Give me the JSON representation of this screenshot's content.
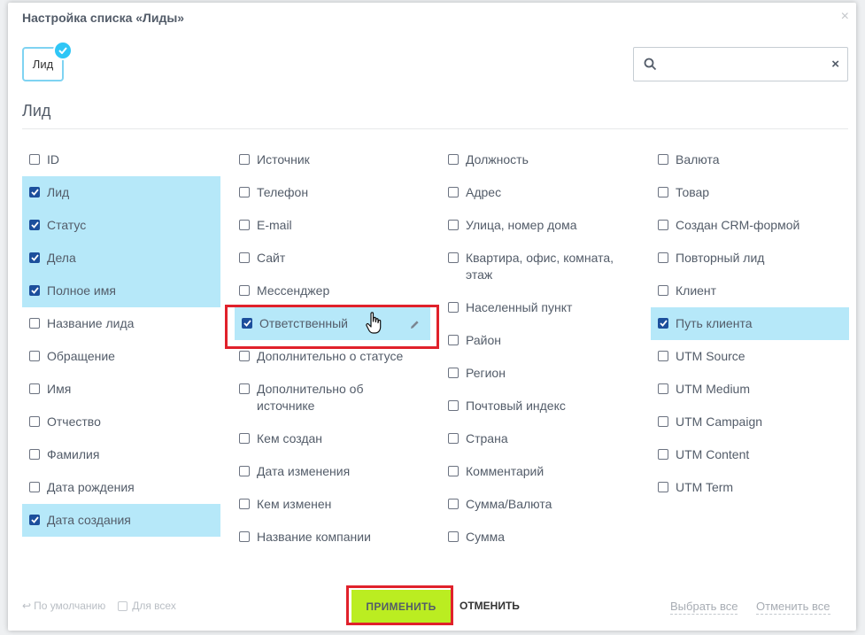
{
  "dialog": {
    "title": "Настройка списка «Лиды»",
    "close_icon": "close-icon"
  },
  "entity_tag": {
    "label": "Лид",
    "selected": true
  },
  "search": {
    "value": "",
    "placeholder": ""
  },
  "section_title": "Лид",
  "colors": {
    "checked_bg": "#b6e8f9",
    "checkbox_fill": "#1c4f9c",
    "apply_bg": "#bbed21",
    "highlight_border": "#e0212b"
  },
  "columns": [
    [
      {
        "label": "ID",
        "checked": false
      },
      {
        "label": "Лид",
        "checked": true
      },
      {
        "label": "Статус",
        "checked": true
      },
      {
        "label": "Дела",
        "checked": true
      },
      {
        "label": "Полное имя",
        "checked": true
      },
      {
        "label": "Название лида",
        "checked": false
      },
      {
        "label": "Обращение",
        "checked": false
      },
      {
        "label": "Имя",
        "checked": false
      },
      {
        "label": "Отчество",
        "checked": false
      },
      {
        "label": "Фамилия",
        "checked": false
      },
      {
        "label": "Дата рождения",
        "checked": false
      },
      {
        "label": "Дата создания",
        "checked": true
      }
    ],
    [
      {
        "label": "Источник",
        "checked": false
      },
      {
        "label": "Телефон",
        "checked": false
      },
      {
        "label": "E-mail",
        "checked": false
      },
      {
        "label": "Сайт",
        "checked": false
      },
      {
        "label": "Мессенджер",
        "checked": false
      },
      {
        "label": "Ответственный",
        "checked": true,
        "hover": true
      },
      {
        "label": "Дополнительно о статусе",
        "checked": false
      },
      {
        "label": "Дополнительно об источнике",
        "checked": false
      },
      {
        "label": "Кем создан",
        "checked": false
      },
      {
        "label": "Дата изменения",
        "checked": false
      },
      {
        "label": "Кем изменен",
        "checked": false
      },
      {
        "label": "Название компании",
        "checked": false
      }
    ],
    [
      {
        "label": "Должность",
        "checked": false
      },
      {
        "label": "Адрес",
        "checked": false
      },
      {
        "label": "Улица, номер дома",
        "checked": false
      },
      {
        "label": "Квартира, офис, комната, этаж",
        "checked": false
      },
      {
        "label": "Населенный пункт",
        "checked": false
      },
      {
        "label": "Район",
        "checked": false
      },
      {
        "label": "Регион",
        "checked": false
      },
      {
        "label": "Почтовый индекс",
        "checked": false
      },
      {
        "label": "Страна",
        "checked": false
      },
      {
        "label": "Комментарий",
        "checked": false
      },
      {
        "label": "Сумма/Валюта",
        "checked": false
      },
      {
        "label": "Сумма",
        "checked": false
      }
    ],
    [
      {
        "label": "Валюта",
        "checked": false
      },
      {
        "label": "Товар",
        "checked": false
      },
      {
        "label": "Создан CRM-формой",
        "checked": false
      },
      {
        "label": "Повторный лид",
        "checked": false
      },
      {
        "label": "Клиент",
        "checked": false
      },
      {
        "label": "Путь клиента",
        "checked": true
      },
      {
        "label": "UTM Source",
        "checked": false
      },
      {
        "label": "UTM Medium",
        "checked": false
      },
      {
        "label": "UTM Campaign",
        "checked": false
      },
      {
        "label": "UTM Content",
        "checked": false
      },
      {
        "label": "UTM Term",
        "checked": false
      }
    ]
  ],
  "footer": {
    "reset_label": "По умолчанию",
    "for_all_label": "Для всех",
    "apply_label": "ПРИМЕНИТЬ",
    "cancel_label": "ОТМЕНИТЬ",
    "select_all_label": "Выбрать все",
    "deselect_all_label": "Отменить все"
  }
}
